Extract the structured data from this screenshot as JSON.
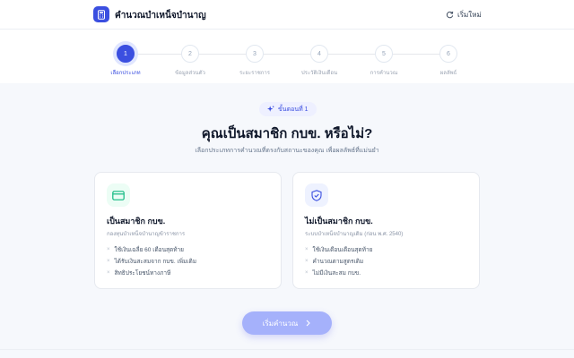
{
  "header": {
    "logo_icon": "calculator-icon",
    "title": "คำนวณบำเหน็จบำนาญ",
    "restart_icon": "refresh-icon",
    "restart_label": "เริ่มใหม่"
  },
  "stepper": {
    "active_step": 1,
    "steps": [
      {
        "number": "1",
        "label": "เลือกประเภท"
      },
      {
        "number": "2",
        "label": "ข้อมูลส่วนตัว"
      },
      {
        "number": "3",
        "label": "ระยะราชการ"
      },
      {
        "number": "4",
        "label": "ประวัติเงินเดือน"
      },
      {
        "number": "5",
        "label": "การคำนวณ"
      },
      {
        "number": "6",
        "label": "ผลลัพธ์"
      }
    ]
  },
  "main": {
    "badge_icon": "sparkle-icon",
    "badge": "ขั้นตอนที่ 1",
    "headline": "คุณเป็นสมาชิก กบข. หรือไม่?",
    "subhead": "เลือกประเภทการคำนวณที่ตรงกับสถานะของคุณ เพื่อผลลัพธ์ที่แม่นยำ"
  },
  "cards": [
    {
      "icon": "credit-card-icon",
      "icon_color": "#10b981",
      "icon_bg": "#ecfdf5",
      "title": "เป็นสมาชิก กบข.",
      "desc": "กองทุนบำเหน็จบำนาญข้าราชการ",
      "features": [
        "ใช้เงินเฉลี่ย 60 เดือนสุดท้าย",
        "ได้รับเงินสะสมจาก กบข. เพิ่มเติม",
        "สิทธิประโยชน์ทางภาษี"
      ]
    },
    {
      "icon": "shield-check-icon",
      "icon_color": "#3b4fe0",
      "icon_bg": "#eef2ff",
      "title": "ไม่เป็นสมาชิก กบข.",
      "desc": "ระบบบำเหน็จบำนาญเดิม (ก่อน พ.ศ. 2540)",
      "features": [
        "ใช้เงินเดือนเดือนสุดท้าย",
        "คำนวณตามสูตรเดิม",
        "ไม่มีเงินสะสม กบข."
      ]
    }
  ],
  "actions": {
    "start_label": "เริ่มคำนวณ",
    "start_icon": "chevron-right-icon"
  },
  "colors": {
    "accent": "#3b4fe0",
    "button_disabled": "#a5b1fb"
  }
}
